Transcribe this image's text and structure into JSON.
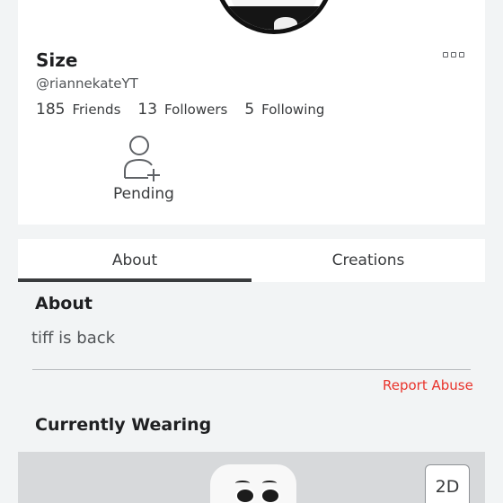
{
  "profile": {
    "display_name": "Size",
    "username": "@riannekateYT",
    "more_icon": "ellipsis-icon",
    "stats": [
      {
        "count": "185",
        "label": "Friends"
      },
      {
        "count": "13",
        "label": "Followers"
      },
      {
        "count": "5",
        "label": "Following"
      }
    ],
    "pending": {
      "label": "Pending",
      "icon": "add-friend-icon"
    }
  },
  "tabs": [
    {
      "label": "About",
      "active": true
    },
    {
      "label": "Creations",
      "active": false
    }
  ],
  "about": {
    "title": "About",
    "bio": "tiff is back",
    "report_label": "Report Abuse"
  },
  "wearing": {
    "title": "Currently Wearing",
    "view_toggle_label": "2D"
  },
  "colors": {
    "background": "#f2f4f5",
    "report": "#e9332b",
    "text": "#393b3d"
  }
}
